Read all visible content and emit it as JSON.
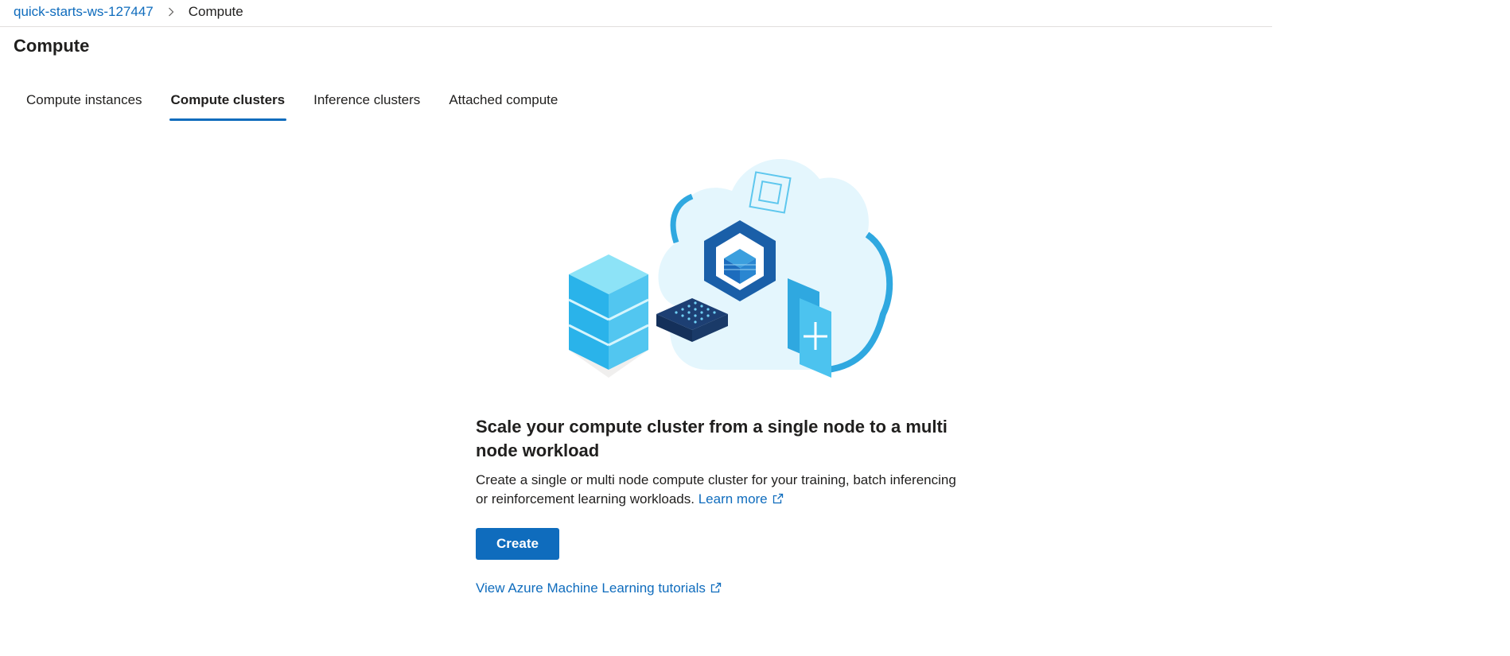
{
  "breadcrumb": {
    "workspace": "quick-starts-ws-127447",
    "current": "Compute"
  },
  "page_title": "Compute",
  "tabs": [
    {
      "label": "Compute instances",
      "active": false
    },
    {
      "label": "Compute clusters",
      "active": true
    },
    {
      "label": "Inference clusters",
      "active": false
    },
    {
      "label": "Attached compute",
      "active": false
    }
  ],
  "empty_state": {
    "heading": "Scale your compute cluster from a single node to a multi node workload",
    "description": "Create a single or multi node compute cluster for your training, batch inferencing or reinforcement learning workloads.",
    "learn_more": "Learn more",
    "create_label": "Create",
    "tutorials_link": "View Azure Machine Learning tutorials"
  },
  "colors": {
    "accent": "#0f6cbd",
    "text": "#201f1e",
    "divider": "#e1dfdd"
  }
}
